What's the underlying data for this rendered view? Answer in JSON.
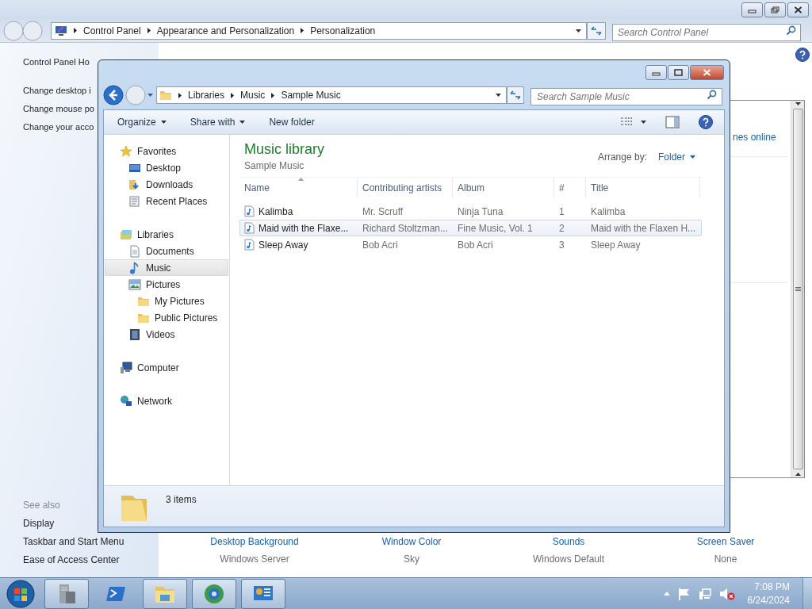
{
  "control_panel": {
    "address": {
      "crumbs": [
        "Control Panel",
        "Appearance and Personalization",
        "Personalization"
      ]
    },
    "search": {
      "placeholder": "Search Control Panel"
    },
    "left_pane": {
      "home": "Control Panel Ho",
      "tasks": [
        "Change desktop i",
        "Change mouse po",
        "Change your acco"
      ],
      "see_also_label": "See also",
      "see_also": [
        "Display",
        "Taskbar and Start Menu",
        "Ease of Access Center"
      ]
    },
    "side_link": "nes online",
    "settings": [
      {
        "label": "Desktop Background",
        "value": "Windows Server"
      },
      {
        "label": "Window Color",
        "value": "Sky"
      },
      {
        "label": "Sounds",
        "value": "Windows Default"
      },
      {
        "label": "Screen Saver",
        "value": "None"
      }
    ]
  },
  "explorer": {
    "address": {
      "crumbs": [
        "Libraries",
        "Music",
        "Sample Music"
      ]
    },
    "search": {
      "placeholder": "Search Sample Music"
    },
    "toolbar": [
      {
        "label": "Organize",
        "menu": true
      },
      {
        "label": "Share with",
        "menu": true
      },
      {
        "label": "New folder",
        "menu": false
      }
    ],
    "nav": [
      {
        "label": "Favorites",
        "kind": "star",
        "selected": false,
        "children": [
          {
            "label": "Desktop",
            "kind": "desktop",
            "selected": false
          },
          {
            "label": "Downloads",
            "kind": "downloads",
            "selected": false
          },
          {
            "label": "Recent Places",
            "kind": "recent",
            "selected": false
          }
        ]
      },
      {
        "label": "Libraries",
        "kind": "library",
        "selected": false,
        "children": [
          {
            "label": "Documents",
            "kind": "documents",
            "selected": false
          },
          {
            "label": "Music",
            "kind": "music",
            "selected": true
          },
          {
            "label": "Pictures",
            "kind": "pictures",
            "selected": false,
            "children": [
              {
                "label": "My Pictures",
                "kind": "folder",
                "selected": false
              },
              {
                "label": "Public Pictures",
                "kind": "folder",
                "selected": false
              }
            ]
          },
          {
            "label": "Videos",
            "kind": "videos",
            "selected": false
          }
        ]
      },
      {
        "label": "Computer",
        "kind": "computer",
        "selected": false
      },
      {
        "label": "Network",
        "kind": "network",
        "selected": false
      }
    ],
    "library": {
      "title": "Music library",
      "subtitle": "Sample Music",
      "arrange_label": "Arrange by:",
      "arrange_value": "Folder"
    },
    "columns": [
      {
        "label": "Name",
        "sorted": true
      },
      {
        "label": "Contributing artists",
        "sorted": false
      },
      {
        "label": "Album",
        "sorted": false
      },
      {
        "label": "#",
        "sorted": false
      },
      {
        "label": "Title",
        "sorted": false
      }
    ],
    "rows": [
      {
        "cells": [
          "Kalimba",
          "Mr. Scruff",
          "Ninja Tuna",
          "1",
          "Kalimba"
        ],
        "hovered": false
      },
      {
        "cells": [
          "Maid with the Flaxe...",
          "Richard Stoltzman...",
          "Fine Music, Vol. 1",
          "2",
          "Maid with the Flaxen H..."
        ],
        "hovered": true
      },
      {
        "cells": [
          "Sleep Away",
          "Bob Acri",
          "Bob Acri",
          "3",
          "Sleep Away"
        ],
        "hovered": false
      }
    ],
    "status": "3 items"
  },
  "taskbar": {
    "apps": [
      {
        "kind": "server-manager",
        "running": true
      },
      {
        "kind": "powershell",
        "running": false
      },
      {
        "kind": "explorer",
        "running": true
      },
      {
        "kind": "browser",
        "running": true
      },
      {
        "kind": "control-panel",
        "running": true
      }
    ],
    "clock": {
      "time": "7:08 PM",
      "date": "6/24/2024"
    }
  }
}
